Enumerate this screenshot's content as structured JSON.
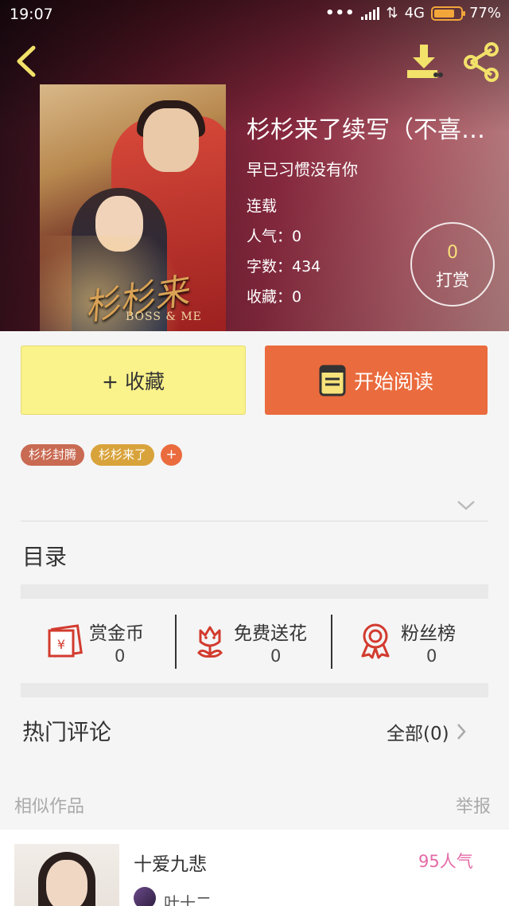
{
  "status_bar": {
    "time": "19:07",
    "network": "4G",
    "battery": "77%",
    "battery_level": 0.77
  },
  "header": {
    "back_icon": "chevron-left-icon",
    "download_icon": "download-icon",
    "share_icon": "share-icon",
    "icon_color": "#f2e26a"
  },
  "book": {
    "cover_title": "杉杉来了",
    "cover_subtitle": "BOSS & ME",
    "title": "杉杉来了续写（不喜勿…",
    "author": "早已习惯没有你",
    "status": "连载",
    "popularity": "人气：0",
    "word_count": "字数：434",
    "favorites": "收藏：0"
  },
  "tip": {
    "count": "0",
    "label": "打赏"
  },
  "actions": {
    "favorite_label": "+ 收藏",
    "read_label": "开始阅读",
    "favorite_color": "#faf28a",
    "read_color": "#ea6b3d"
  },
  "tags": [
    {
      "label": "杉杉封腾",
      "color": "#c96a52"
    },
    {
      "label": "杉杉来了",
      "color": "#d9a33b"
    }
  ],
  "tag_add": "+",
  "catalog": {
    "title": "目录"
  },
  "stats": [
    {
      "label": "赏金币",
      "value": "0",
      "icon": "red-envelope-icon"
    },
    {
      "label": "免费送花",
      "value": "0",
      "icon": "flower-icon"
    },
    {
      "label": "粉丝榜",
      "value": "0",
      "icon": "medal-icon"
    }
  ],
  "comments": {
    "title": "热门评论",
    "all_label": "全部(0)"
  },
  "similar": {
    "label": "相似作品",
    "report": "举报",
    "items": [
      {
        "title": "十爱九悲",
        "popularity": "95人气",
        "author": "叶十二"
      }
    ]
  }
}
